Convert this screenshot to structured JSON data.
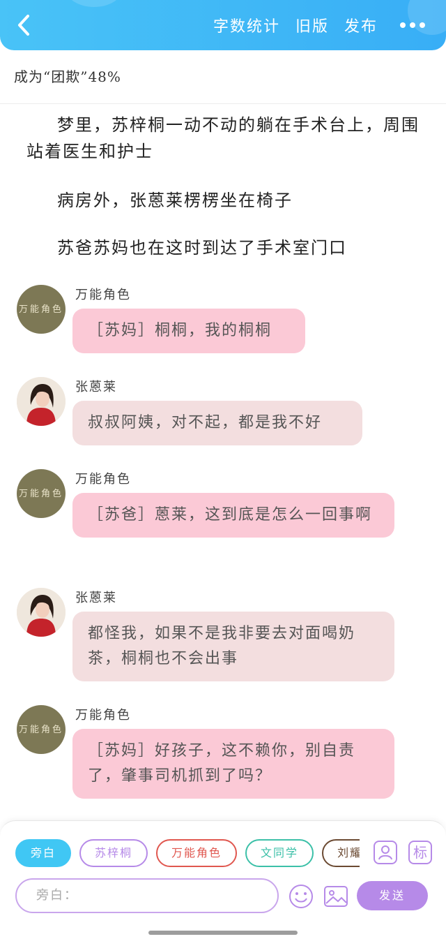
{
  "header": {
    "back_label": "back",
    "actions": [
      "字数统计",
      "旧版",
      "发布"
    ],
    "more_label": "more",
    "background": "#3bb3f6"
  },
  "progress_text": "成为“团欺”48%",
  "narration": [
    "梦里，苏梓桐一动不动的躺在手术台上，周围站着医生和护士",
    "病房外，张蒽莱楞楞坐在椅子",
    "苏爸苏妈也在这时到达了手术室门口"
  ],
  "messages": [
    {
      "sender": "万能角色",
      "avatar": "omni",
      "avatar_text": "万能角色",
      "text": "［苏妈］桐桐，我的桐桐",
      "bubble_color": "#fbc9d6"
    },
    {
      "sender": "张蒽莱",
      "avatar": "girl",
      "text": "叔叔阿姨，对不起，都是我不好",
      "bubble_color": "#f3dedf"
    },
    {
      "sender": "万能角色",
      "avatar": "omni",
      "avatar_text": "万能角色",
      "text": "［苏爸］蒽莱，这到底是怎么一回事啊",
      "bubble_color": "#fbc9d6"
    },
    {
      "sender": "张蒽莱",
      "avatar": "girl",
      "text": "都怪我，如果不是我非要去对面喝奶茶，桐桐也不会出事",
      "bubble_color": "#f3dedf"
    },
    {
      "sender": "万能角色",
      "avatar": "omni",
      "avatar_text": "万能角色",
      "text": "［苏妈］好孩子，这不赖你，别自责了，肇事司机抓到了吗？",
      "bubble_color": "#fbc9d6"
    }
  ],
  "roles": [
    {
      "label": "旁白",
      "color": "#40c7f4",
      "active": true
    },
    {
      "label": "苏梓桐",
      "color": "#b68ae8",
      "active": false
    },
    {
      "label": "万能角色",
      "color": "#e0574f",
      "active": false
    },
    {
      "label": "文同学",
      "color": "#3cc0a8",
      "active": false
    },
    {
      "label": "刘耀文",
      "color": "#6b4a32",
      "active": false
    }
  ],
  "label_icon_text": "标",
  "input": {
    "placeholder": "旁白："
  },
  "send_label": "发送"
}
